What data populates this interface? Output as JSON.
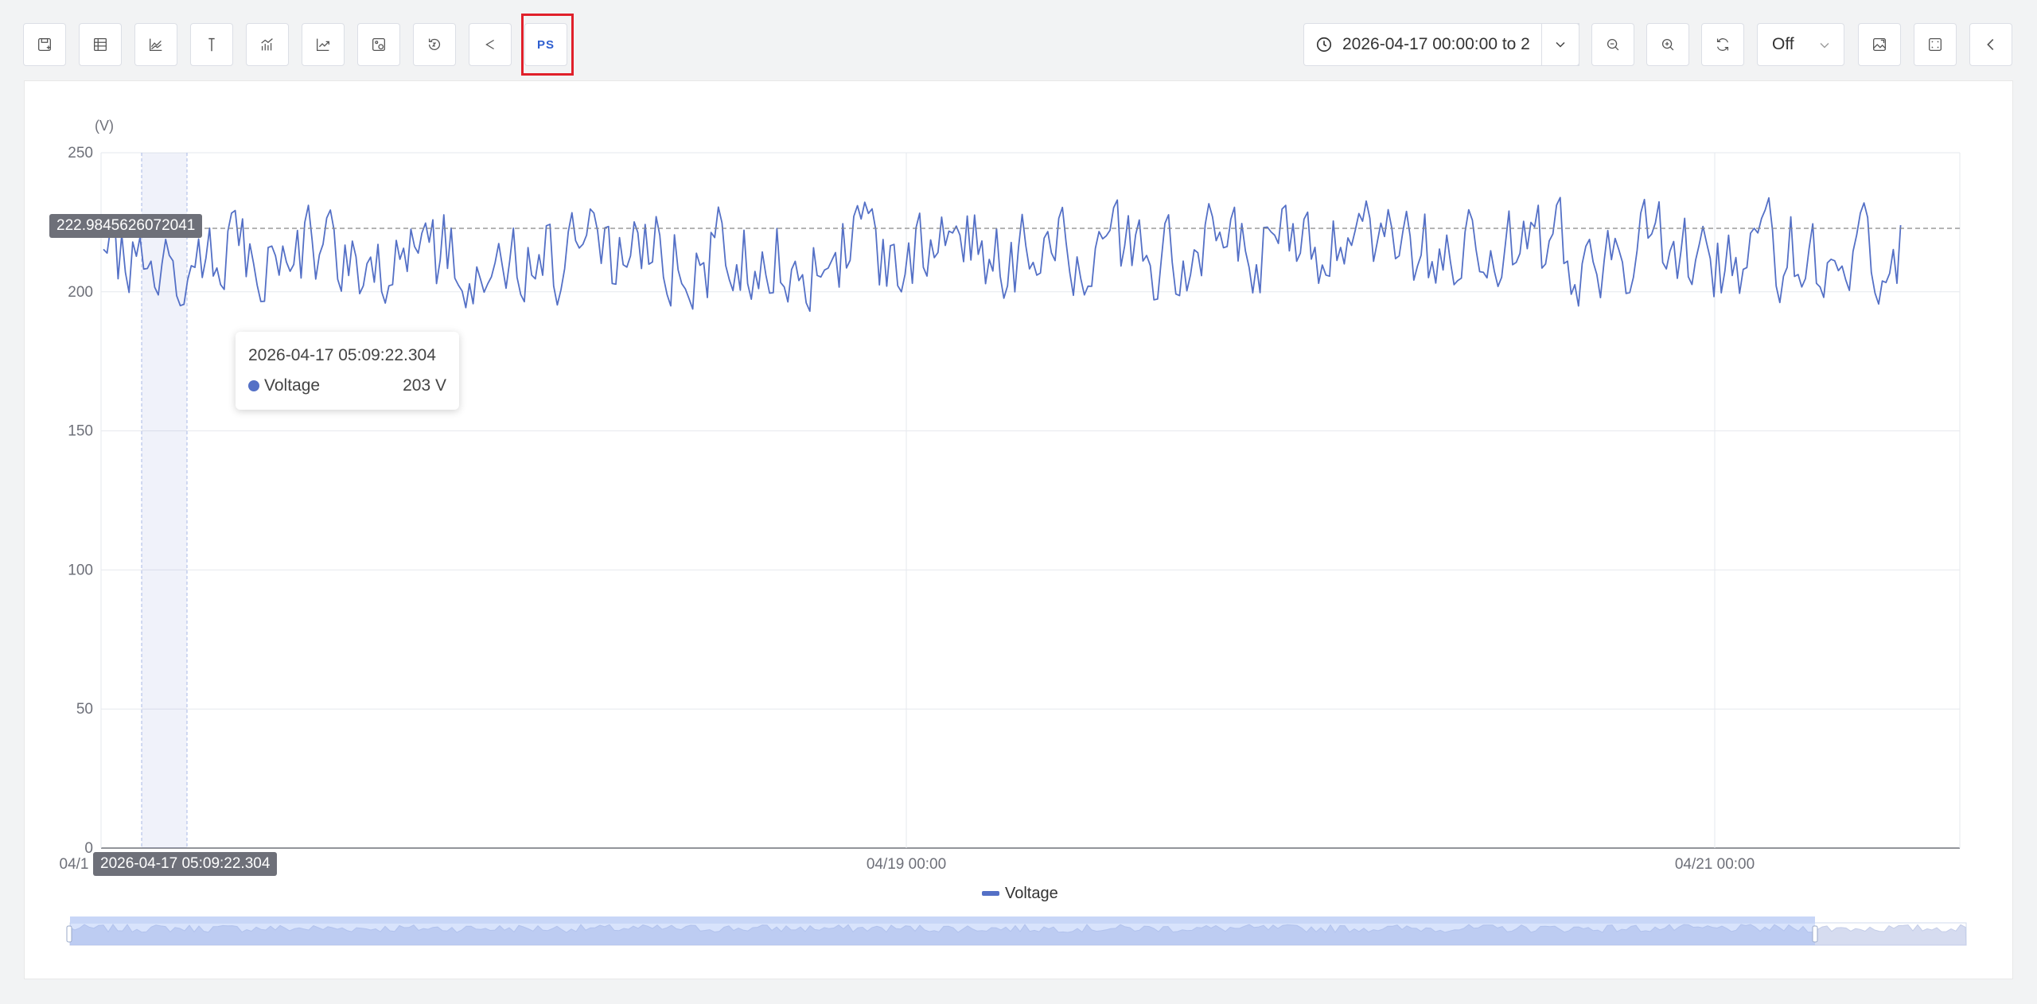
{
  "toolbar": {
    "left_buttons": [
      {
        "name": "save-view-icon"
      },
      {
        "name": "table-view-icon"
      },
      {
        "name": "line-chart-icon"
      },
      {
        "name": "marker-icon"
      },
      {
        "name": "statistics-icon"
      },
      {
        "name": "trend-icon"
      },
      {
        "name": "image-settings-icon"
      },
      {
        "name": "history-icon"
      },
      {
        "name": "share-icon"
      }
    ],
    "ps_label": "PS",
    "time_range": "2026-04-17 00:00:00 to 2",
    "refresh_value": "Off"
  },
  "chart_data": {
    "type": "line",
    "yunit": "(V)",
    "ylim": [
      0,
      250
    ],
    "yticks": [
      "250",
      "200",
      "150",
      "100",
      "50",
      "0"
    ],
    "xticks": [
      "04/1",
      "04/19 00:00",
      "04/21 00:00"
    ],
    "series": [
      {
        "name": "Voltage",
        "color": "#5470c6",
        "y_range_approx": [
          190,
          237
        ]
      }
    ],
    "crosshair_y_value": "222.9845626072041",
    "crosshair_x_value": "2026-04-17 05:09:22.304",
    "grid": true,
    "legend": "bottom-center"
  },
  "tooltip": {
    "time": "2026-04-17 05:09:22.304",
    "series": "Voltage",
    "value": "203 V"
  }
}
